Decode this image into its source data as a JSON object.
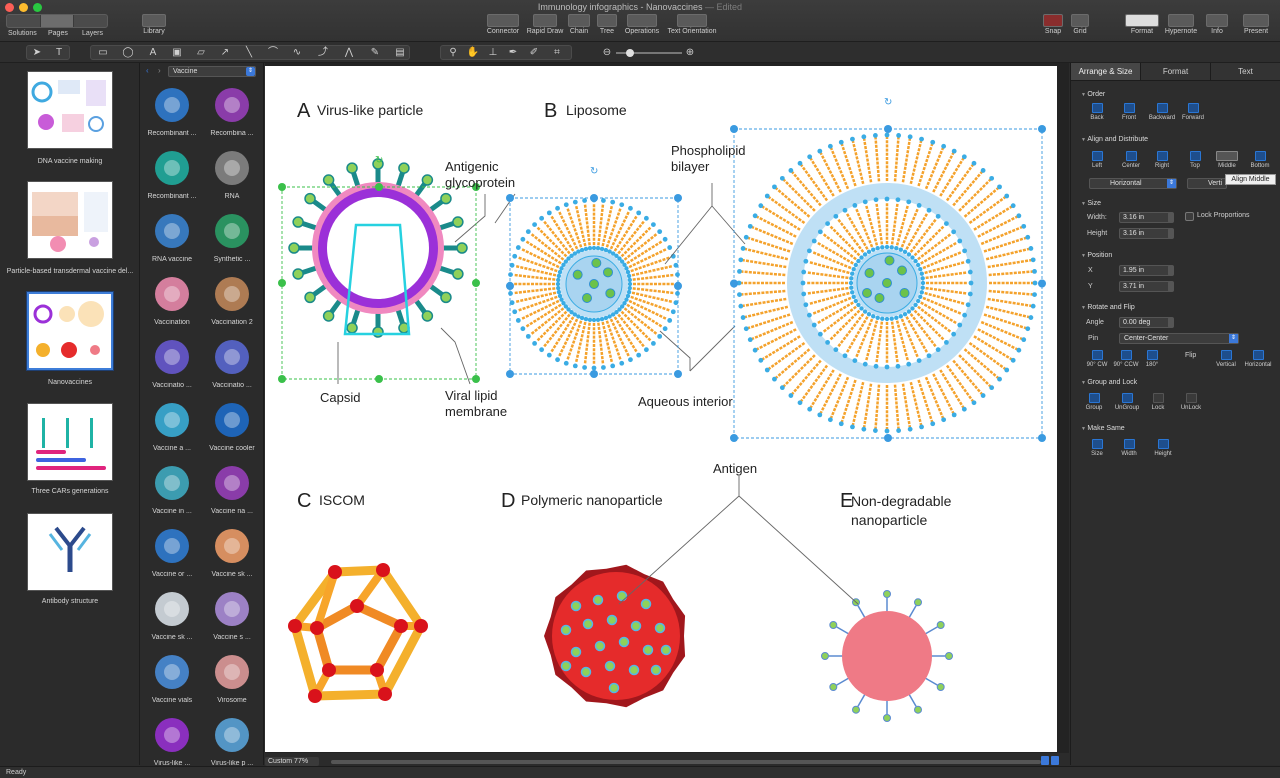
{
  "window": {
    "title": "Immunology infographics - Nanovaccines",
    "edited": "— Edited"
  },
  "toolbar": {
    "solutions": "Solutions",
    "pages": "Pages",
    "layers": "Layers",
    "library": "Library",
    "connector": "Connector",
    "rapid_draw": "Rapid Draw",
    "chain": "Chain",
    "tree": "Tree",
    "operations": "Operations",
    "text_orientation": "Text Orientation",
    "snap": "Snap",
    "grid": "Grid",
    "format": "Format",
    "hypernote": "Hypernote",
    "info": "Info",
    "present": "Present"
  },
  "pages": [
    {
      "label": "DNA vaccine making"
    },
    {
      "label": "Particle-based transdermal vaccine del..."
    },
    {
      "label": "Nanovaccines"
    },
    {
      "label": "Three CARs generations"
    },
    {
      "label": "Antibody structure"
    }
  ],
  "library": {
    "category": "Vaccine",
    "items": [
      "Recombinant ...",
      "Recombina ...",
      "Recombinant ...",
      "RNA",
      "RNA vaccine",
      "Synthetic ...",
      "Vaccination",
      "Vaccination 2",
      "Vaccinatio ...",
      "Vaccinatio ...",
      "Vaccine a ...",
      "Vaccine cooler",
      "Vaccine in ...",
      "Vaccine na ...",
      "Vaccine or ...",
      "Vaccine sk ...",
      "Vaccine sk ...",
      "Vaccine s ...",
      "Vaccine vials",
      "Virosome",
      "Virus-like ...",
      "Virus-like p ..."
    ]
  },
  "diagram": {
    "a_letter": "A",
    "a_title": "Virus-like particle",
    "b_letter": "B",
    "b_title": "Liposome",
    "c_letter": "C",
    "c_title": "ISCOM",
    "d_letter": "D",
    "d_title": "Polymeric nanoparticle",
    "e_letter": "E",
    "e_title": "Non-degradable nanoparticle",
    "antigenic": "Antigenic glycoprotein",
    "phospholipid": "Phospholipid bilayer",
    "capsid": "Capsid",
    "viral_lipid": "Viral lipid membrane",
    "aqueous": "Aqueous interior",
    "antigen": "Antigen"
  },
  "bottom": {
    "zoom": "Custom 77%",
    "status": "Ready"
  },
  "inspector": {
    "tabs": [
      "Arrange & Size",
      "Format",
      "Text"
    ],
    "order": "Order",
    "order_btns": [
      "Back",
      "Front",
      "Backward",
      "Forward"
    ],
    "align": "Align and Distribute",
    "align_btns": [
      "Left",
      "Center",
      "Right",
      "Top",
      "Middle",
      "Bottom"
    ],
    "horizontal": "Horizontal",
    "vertical": "Verti",
    "tooltip": "Align Middle",
    "size": "Size",
    "width_label": "Width:",
    "width": "3.16 in",
    "height_label": "Height",
    "height": "3.16 in",
    "lock": "Lock Proportions",
    "position": "Position",
    "x_label": "X",
    "x": "1.95 in",
    "y_label": "Y",
    "y": "3.71 in",
    "rotate": "Rotate and Flip",
    "angle_label": "Angle",
    "angle": "0.00 deg",
    "pin_label": "Pin",
    "pin": "Center-Center",
    "rot_btns": [
      "90° CW",
      "90° CCW",
      "180°"
    ],
    "flip_label": "Flip",
    "flip_btns": [
      "Vertical",
      "Horizontal"
    ],
    "group": "Group and Lock",
    "group_btns": [
      "Group",
      "UnGroup",
      "Lock",
      "UnLock"
    ],
    "make_same": "Make Same",
    "make_btns": [
      "Size",
      "Width",
      "Height"
    ]
  },
  "colors": {
    "accent": "#3b78d9",
    "virus_purple": "#9b30d8",
    "liposome_orange": "#f4a22c",
    "aqueous_blue": "#bfe0f5",
    "ball_green": "#6cc24a",
    "red": "#e52b2b",
    "pink": "#ef7a86"
  }
}
